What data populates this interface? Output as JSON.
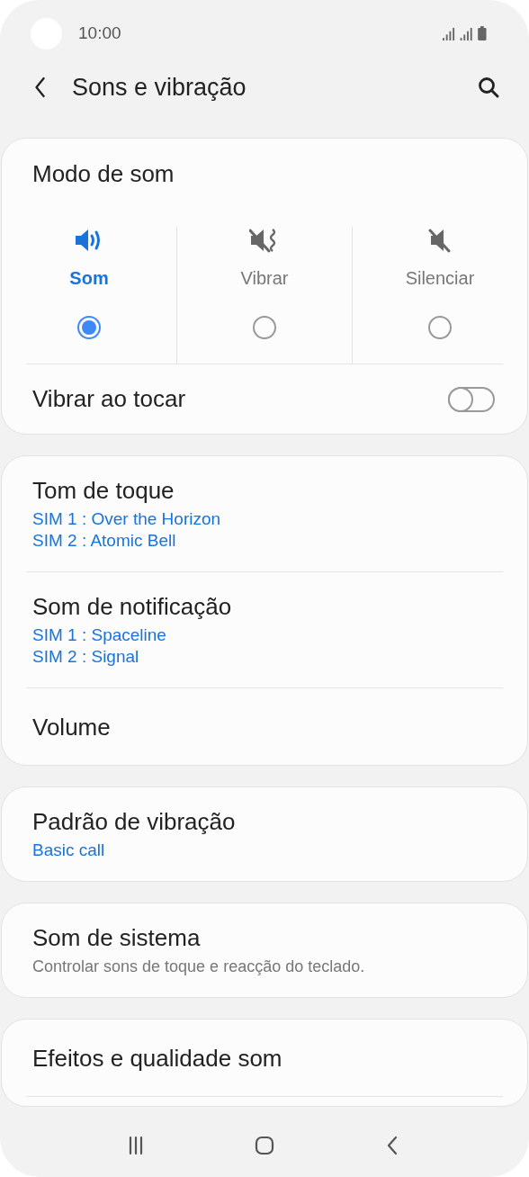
{
  "status_bar": {
    "time": "10:00"
  },
  "header": {
    "title": "Sons e vibração"
  },
  "sound_mode": {
    "title": "Modo de som",
    "options": [
      {
        "label": "Som",
        "kind": "sound",
        "selected": true
      },
      {
        "label": "Vibrar",
        "kind": "vibrate",
        "selected": false
      },
      {
        "label": "Silenciar",
        "kind": "mute",
        "selected": false
      }
    ],
    "toggle_row": {
      "label": "Vibrar ao tocar",
      "on": false
    }
  },
  "groups": [
    {
      "items": [
        {
          "title": "Tom de toque",
          "kind": "value",
          "subtitles": [
            "SIM 1 : Over the Horizon",
            "SIM 2 : Atomic Bell"
          ]
        },
        {
          "title": "Som de notificação",
          "kind": "value",
          "subtitles": [
            "SIM 1 : Spaceline",
            "SIM 2 : Signal"
          ]
        },
        {
          "title": "Volume"
        }
      ]
    },
    {
      "items": [
        {
          "title": "Padrão de vibração",
          "kind": "value",
          "subtitles": [
            "Basic call"
          ]
        }
      ]
    },
    {
      "items": [
        {
          "title": "Som de sistema",
          "kind": "description",
          "subtitles": [
            "Controlar sons de toque e reacção do teclado."
          ]
        }
      ]
    },
    {
      "items": [
        {
          "title": "Efeitos e qualidade som"
        }
      ]
    }
  ]
}
